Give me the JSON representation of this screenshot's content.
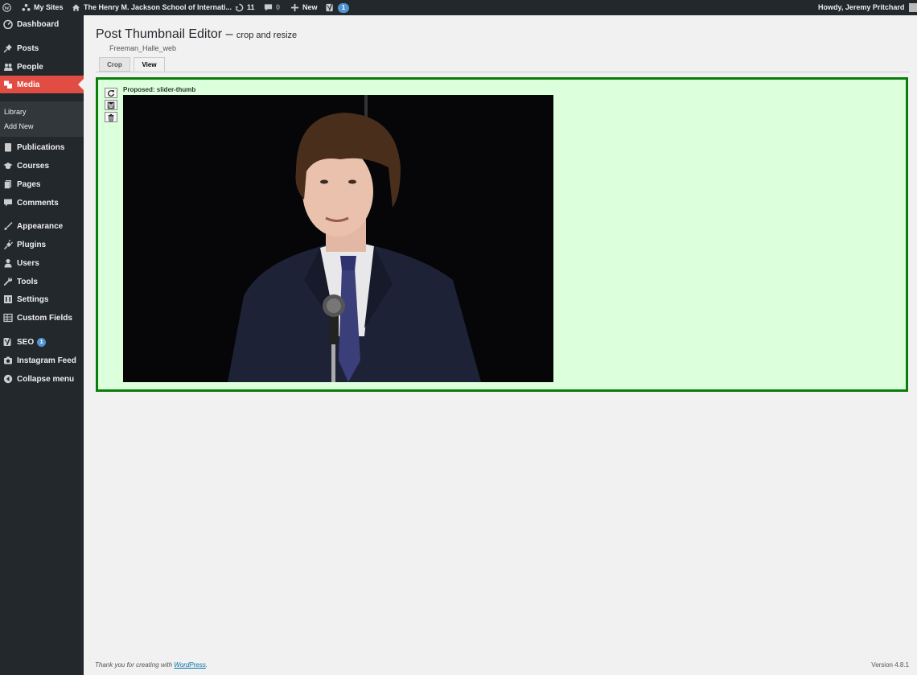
{
  "adminbar": {
    "my_sites": "My Sites",
    "site_name": "The Henry M. Jackson School of Internati...",
    "updates_count": "11",
    "comments_count": "0",
    "new_label": "New",
    "seo_count": "1",
    "howdy": "Howdy, Jeremy Pritchard"
  },
  "sidebar": {
    "items": [
      {
        "label": "Dashboard",
        "icon": "dashboard-icon"
      },
      {
        "label": "Posts",
        "icon": "pin-icon"
      },
      {
        "label": "People",
        "icon": "people-icon"
      },
      {
        "label": "Media",
        "icon": "media-icon"
      },
      {
        "label": "Publications",
        "icon": "book-icon"
      },
      {
        "label": "Courses",
        "icon": "mortarboard-icon"
      },
      {
        "label": "Pages",
        "icon": "pages-icon"
      },
      {
        "label": "Comments",
        "icon": "comment-icon"
      },
      {
        "label": "Appearance",
        "icon": "brush-icon"
      },
      {
        "label": "Plugins",
        "icon": "plug-icon"
      },
      {
        "label": "Users",
        "icon": "user-icon"
      },
      {
        "label": "Tools",
        "icon": "wrench-icon"
      },
      {
        "label": "Settings",
        "icon": "settings-icon"
      },
      {
        "label": "Custom Fields",
        "icon": "table-icon"
      },
      {
        "label": "SEO",
        "icon": "yoast-icon",
        "badge": "1"
      },
      {
        "label": "Instagram Feed",
        "icon": "camera-icon"
      },
      {
        "label": "Collapse menu",
        "icon": "collapse-icon"
      }
    ],
    "media_submenu": [
      "Library",
      "Add New"
    ]
  },
  "page": {
    "title": "Post Thumbnail Editor –",
    "subtitle": "crop and resize",
    "filename": "Freeman_Halle_web",
    "tabs": [
      "Crop",
      "View"
    ],
    "proposed_label": "Proposed: slider-thumb"
  },
  "footer": {
    "thanks": "Thank you for creating with ",
    "wordpress_link": "WordPress",
    "period": ".",
    "version": "Version 4.8.1"
  },
  "colors": {
    "adminbar_bg": "#23282d",
    "active_menu": "#e14d43",
    "panel_border": "#0a7d0a",
    "panel_bg": "#dcffdc",
    "badge": "#4f94d4"
  }
}
